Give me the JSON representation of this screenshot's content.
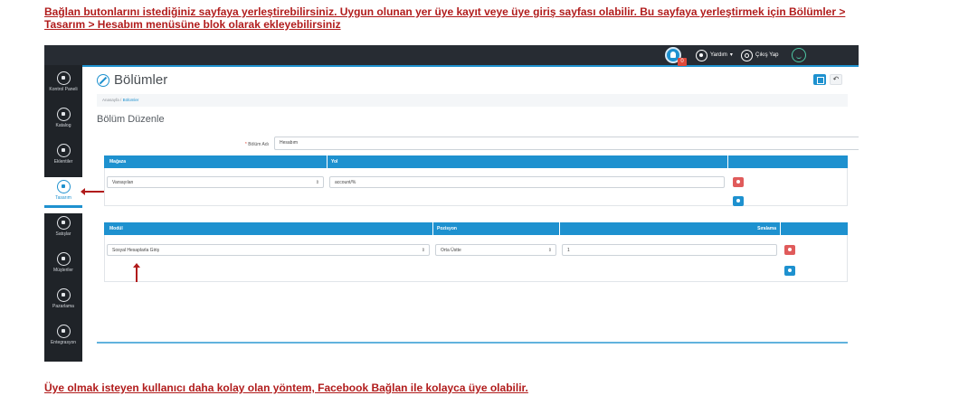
{
  "notes": {
    "top": "Bağlan butonlarını istediğiniz sayfaya yerleştirebilirsiniz. Uygun olunan yer üye kayıt veye üye giriş sayfası olabilir. Bu sayfaya yerleştirmek için Bölümler > Tasarım > Hesabım menüsüne blok olarak ekleyebilirsiniz",
    "bottom": "Üye olmak isteyen kullanıcı daha kolay olan yöntem, Facebook Bağlan ile kolayca üye olabilir."
  },
  "topbar": {
    "notification_icon": "bell-icon",
    "notification_count": "0",
    "help_label": "Yardım",
    "help_caret": "▾",
    "logout_label": "Çıkış Yap"
  },
  "sidebar": {
    "items": [
      {
        "label": "Kontrol Paneli",
        "icon": "dashboard-icon"
      },
      {
        "label": "Katalog",
        "icon": "tag-icon"
      },
      {
        "label": "Eklentiler",
        "icon": "puzzle-icon"
      },
      {
        "label": "Tasarım",
        "icon": "monitor-icon"
      },
      {
        "label": "Satışlar",
        "icon": "dollar-icon"
      },
      {
        "label": "Müşteriler",
        "icon": "user-icon"
      },
      {
        "label": "Pazarlama",
        "icon": "star-icon"
      },
      {
        "label": "Entegrasyon",
        "icon": "download-icon"
      }
    ],
    "active": "Tasarım"
  },
  "page": {
    "title": "Bölümler",
    "back_glyph": "↶",
    "breadcrumb_home": "Anasayfa",
    "breadcrumb_sep": "/",
    "breadcrumb_current": "Bölümler",
    "section_title": "Bölüm Düzenle",
    "required_mark": "*",
    "layout_name_label": "Bölüm Adı",
    "layout_name_value": "Hesabım"
  },
  "store_route_table": {
    "headers": [
      "Mağaza",
      "Yol",
      ""
    ],
    "rows": [
      {
        "store": "Varsayılan",
        "route": "account/%"
      }
    ]
  },
  "module_table": {
    "headers": [
      "Modül",
      "Pozisyon",
      "Sıralama"
    ],
    "rows": [
      {
        "module": "Sosyal Hesaplarla Giriş",
        "position": "Orta Üstte",
        "sort": "1"
      }
    ]
  },
  "select_caret": "⇕",
  "colors": {
    "accent": "#1e91cf",
    "danger": "#e05b5b",
    "note": "#b11c1c",
    "topbar": "#272c33",
    "sidebar": "#1f2328"
  }
}
